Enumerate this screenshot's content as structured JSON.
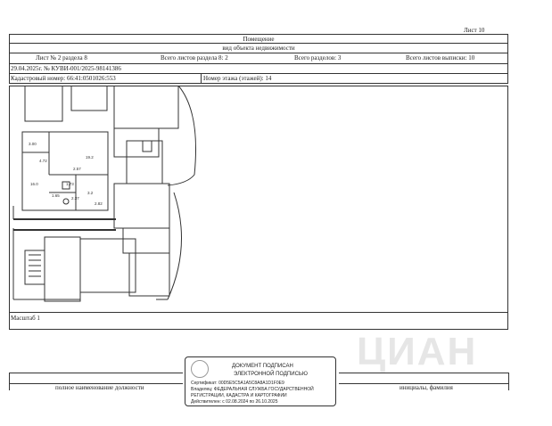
{
  "sheet": {
    "label": "Лист 10"
  },
  "header": {
    "title": "Помещение",
    "subtitle": "вид объекта недвижимости",
    "sheet_section": "Лист № 2 раздела 8",
    "total_sheets_section": "Всего листов раздела 8: 2",
    "total_sections": "Всего разделов: 3",
    "total_sheets_extract": "Всего листов выписки: 10",
    "date_number": "29.04.2025г. № КУВИ-001/2025-98141386",
    "cadastral": "Кадастровый номер: 66:41:0501026:553",
    "floor": "Номер этажа (этажей): 14"
  },
  "plan": {
    "labels": [
      "3.00",
      "4.72",
      "2.57",
      "19.2",
      "16.0",
      "1.73",
      "1.65",
      "2.37",
      "3.2",
      "2.82"
    ]
  },
  "scale": {
    "label": "Масштаб 1"
  },
  "watermark": {
    "text": "ЦИАН"
  },
  "signature": {
    "line1": "ДОКУМЕНТ ПОДПИСАН",
    "line2": "ЭЛЕКТРОННОЙ ПОДПИСЬЮ",
    "cert": "Сертификат: 00D5E5C5A1A5C8A8A1D1F0E9",
    "owner": "Владелец: ФЕДЕРАЛЬНАЯ СЛУЖБА ГОСУДАРСТВЕННОЙ",
    "owner2": "РЕГИСТРАЦИИ, КАДАСТРА И КАРТОГРАФИИ",
    "valid": "Действителен: с 02.08.2024 по 26.10.2025"
  },
  "footer": {
    "position_label": "полное наименование должности",
    "name_label": "инициалы, фамилия"
  }
}
